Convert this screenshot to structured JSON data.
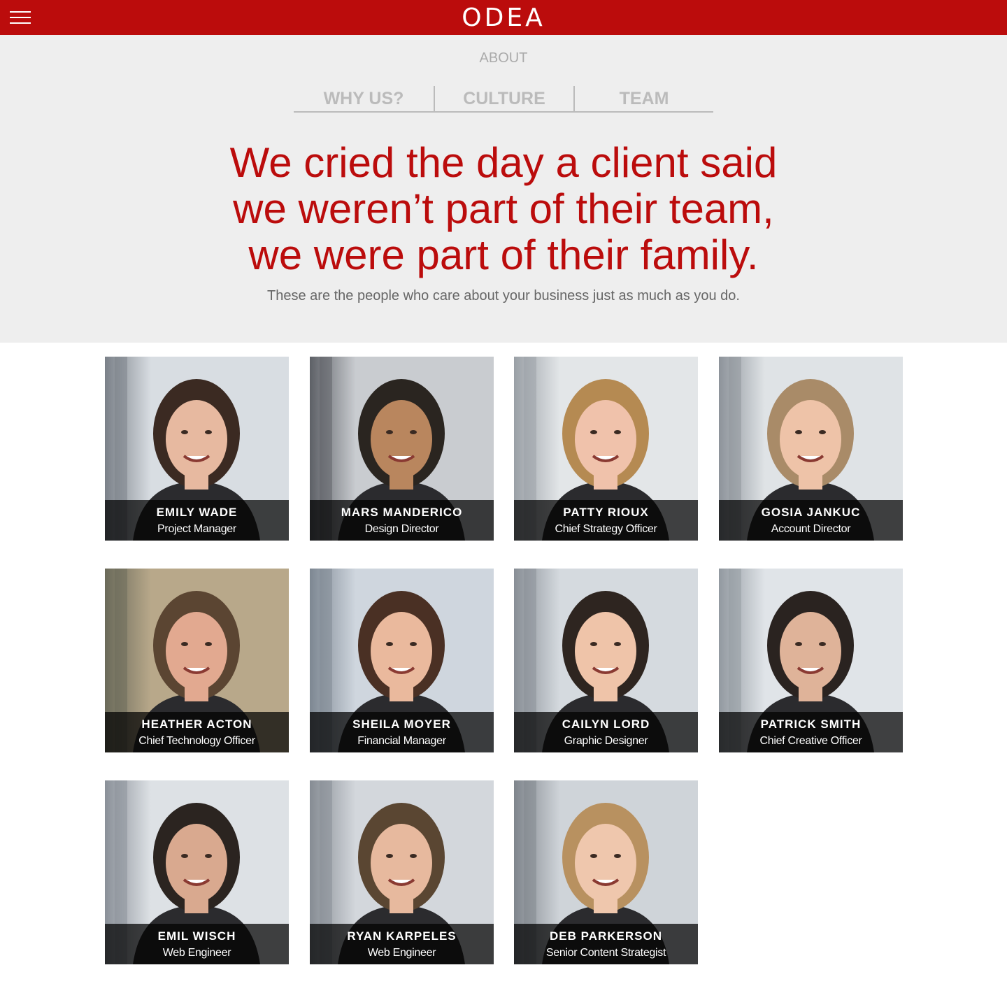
{
  "header": {
    "logo_text": "ODEA",
    "menu_icon": "hamburger-menu-icon",
    "brand_color": "#bb0c0c"
  },
  "hero": {
    "section_label": "ABOUT",
    "tabs": [
      {
        "label": "WHY US?"
      },
      {
        "label": "CULTURE"
      },
      {
        "label": "TEAM"
      }
    ],
    "headline_lines": [
      "We cried the day a client said",
      "we weren’t part of their team,",
      "we were part of their family."
    ],
    "tagline": "These are the people who care about your business just as much as you do."
  },
  "team": [
    {
      "name": "EMILY WADE",
      "role": "Project Manager"
    },
    {
      "name": "MARS MANDERICO",
      "role": "Design Director"
    },
    {
      "name": "PATTY RIOUX",
      "role": "Chief Strategy Officer"
    },
    {
      "name": "GOSIA JANKUC",
      "role": "Account Director"
    },
    {
      "name": "HEATHER ACTON",
      "role": "Chief Technology Officer"
    },
    {
      "name": "SHEILA MOYER",
      "role": "Financial Manager"
    },
    {
      "name": "CAILYN LORD",
      "role": "Graphic Designer"
    },
    {
      "name": "PATRICK SMITH",
      "role": "Chief Creative Officer"
    },
    {
      "name": "EMIL WISCH",
      "role": "Web Engineer"
    },
    {
      "name": "RYAN KARPELES",
      "role": "Web Engineer"
    },
    {
      "name": "DEB PARKERSON",
      "role": "Senior Content Strategist"
    }
  ]
}
